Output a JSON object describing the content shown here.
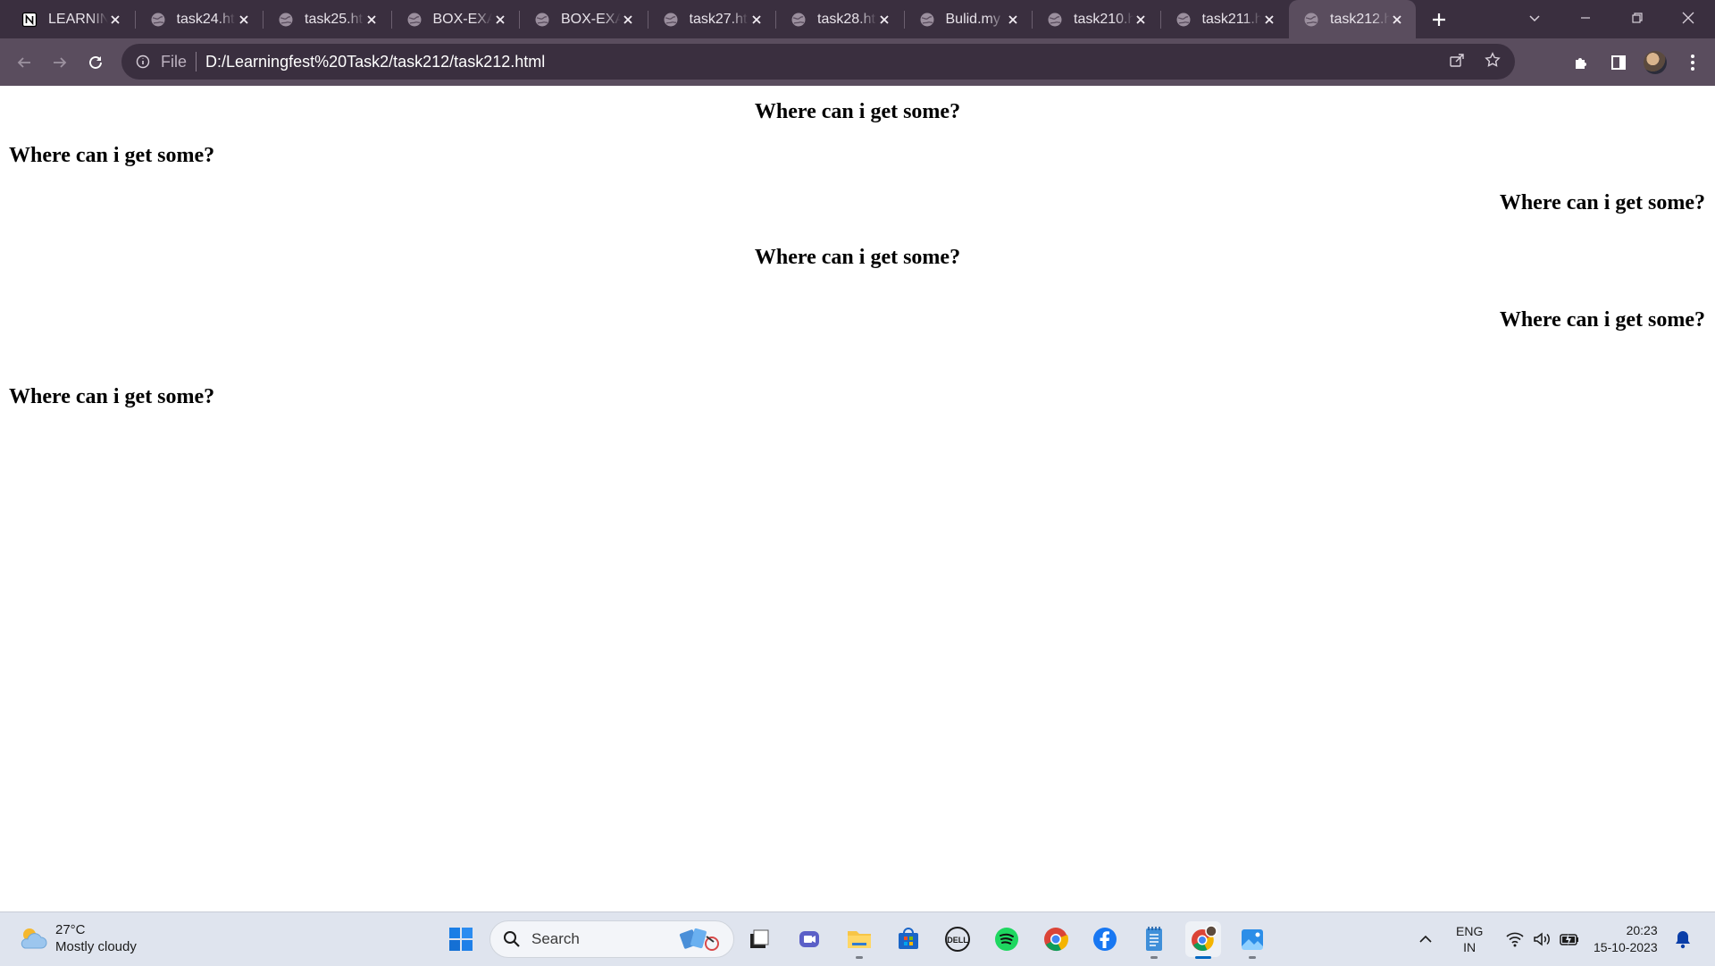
{
  "browser": {
    "tabs": [
      {
        "label": "LEARNIN",
        "icon": "notion-icon"
      },
      {
        "label": "task24.ht",
        "icon": "globe-icon"
      },
      {
        "label": "task25.ht",
        "icon": "globe-icon"
      },
      {
        "label": "BOX-EXA",
        "icon": "globe-icon"
      },
      {
        "label": "BOX-EXA",
        "icon": "globe-icon"
      },
      {
        "label": "task27.ht",
        "icon": "globe-icon"
      },
      {
        "label": "task28.ht",
        "icon": "globe-icon"
      },
      {
        "label": "Bulid.my",
        "icon": "globe-icon"
      },
      {
        "label": "task210.h",
        "icon": "globe-icon"
      },
      {
        "label": "task211.h",
        "icon": "globe-icon"
      },
      {
        "label": "task212.h",
        "icon": "globe-icon",
        "active": true
      }
    ],
    "address": {
      "scheme": "File",
      "url": "D:/Learningfest%20Task2/task212/task212.html"
    }
  },
  "page": {
    "headings": [
      {
        "text": "Where can i get some?",
        "align": "center"
      },
      {
        "text": "Where can i get some?",
        "align": "left"
      },
      {
        "text": "Where can i get some?",
        "align": "right"
      },
      {
        "text": "Where can i get some?",
        "align": "center"
      },
      {
        "text": "Where can i get some?",
        "align": "right"
      },
      {
        "text": "Where can i get some?",
        "align": "left"
      }
    ]
  },
  "taskbar": {
    "weather": {
      "temp": "27°C",
      "condition": "Mostly cloudy"
    },
    "search_label": "Search",
    "pinned": [
      "windows-start-icon",
      "file-explorer-icon",
      "meet-icon",
      "folder-icon",
      "store-icon",
      "dell-icon",
      "spotify-icon",
      "chrome-icon",
      "facebook-icon",
      "notepad-icon",
      "chrome-profile-icon",
      "photos-icon"
    ],
    "lang": {
      "line1": "ENG",
      "line2": "IN"
    },
    "clock": {
      "time": "20:23",
      "date": "15-10-2023"
    }
  },
  "colors": {
    "tabstrip": "#3a2f3f",
    "toolbar": "#5a4d5e",
    "taskbar": "#dfe4ee",
    "accent": "#0067c0"
  }
}
